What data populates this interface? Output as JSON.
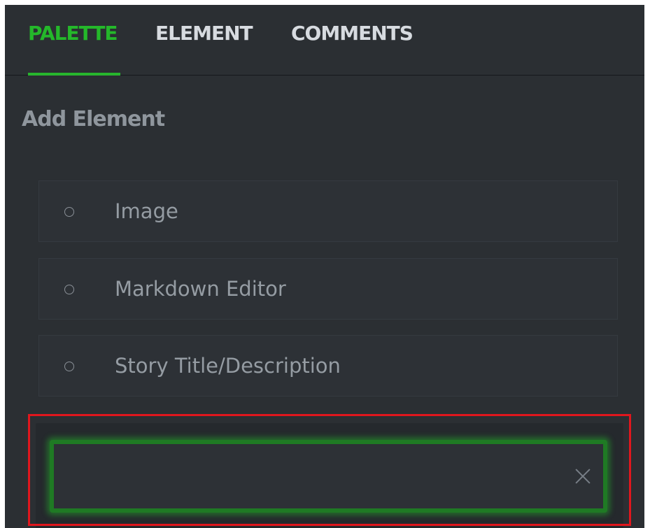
{
  "tabs": [
    {
      "label": "PALETTE",
      "active": true
    },
    {
      "label": "ELEMENT",
      "active": false
    },
    {
      "label": "COMMENTS",
      "active": false
    }
  ],
  "section": {
    "title": "Add Element"
  },
  "elements": [
    {
      "label": "Image",
      "icon": "radio-icon"
    },
    {
      "label": "Markdown Editor",
      "icon": "radio-icon"
    },
    {
      "label": "Story Title/Description",
      "icon": "radio-icon"
    }
  ],
  "search": {
    "value": "",
    "placeholder": "",
    "clear_icon": "close-icon"
  },
  "colors": {
    "panel_bg": "#2b2f33",
    "accent_green": "#24b82a",
    "tab_text": "#d7dbe0",
    "muted_text": "#959ca3",
    "highlight_red": "#e0161d"
  }
}
